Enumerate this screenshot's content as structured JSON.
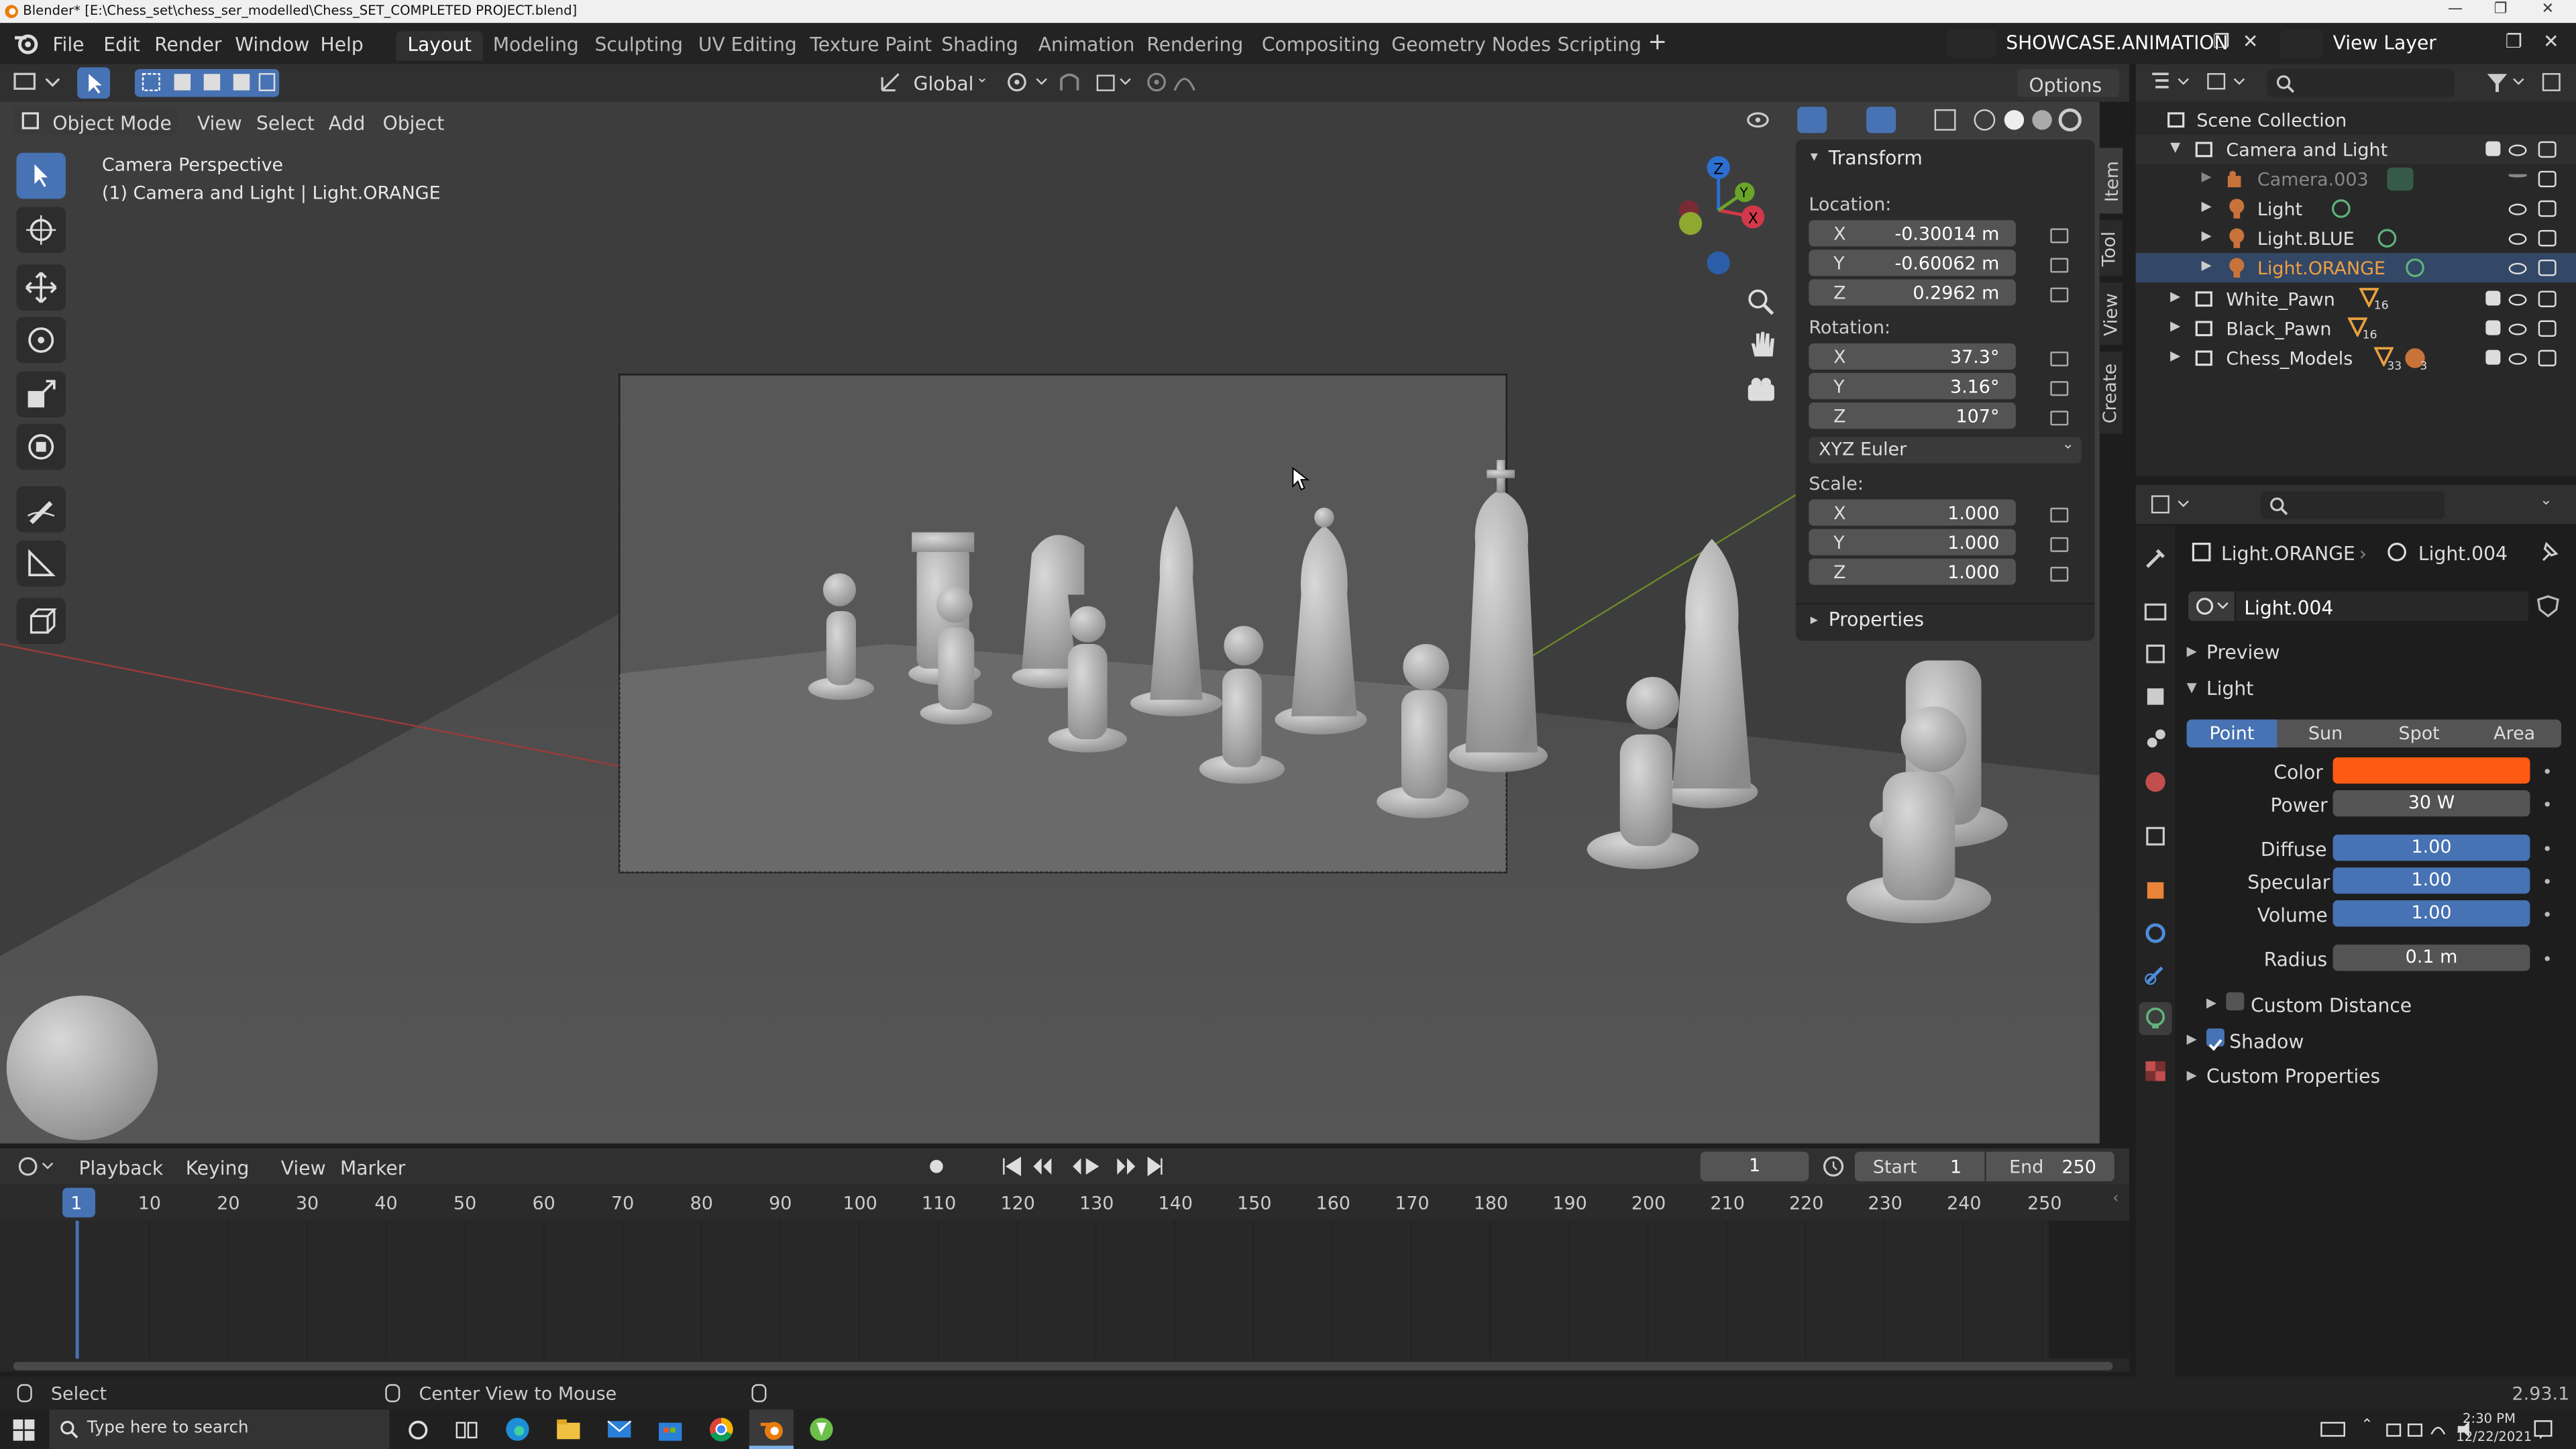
{
  "window": {
    "title": "Blender* [E:\\Chess_set\\chess_ser_modelled\\Chess_SET_COMPLETED PROJECT.blend]"
  },
  "menu": [
    "File",
    "Edit",
    "Render",
    "Window",
    "Help"
  ],
  "workspaces": [
    "Layout",
    "Modeling",
    "Sculpting",
    "UV Editing",
    "Texture Paint",
    "Shading",
    "Animation",
    "Rendering",
    "Compositing",
    "Geometry Nodes",
    "Scripting"
  ],
  "scene": {
    "name": "SHOWCASE.ANIMATION",
    "view_layer": "View Layer"
  },
  "toolbar": {
    "transform_orientation": "Global",
    "options": "Options"
  },
  "viewport_header": {
    "mode": "Object Mode",
    "menus": [
      "View",
      "Select",
      "Add",
      "Object"
    ]
  },
  "viewport": {
    "perspective": "Camera Perspective",
    "context": "(1) Camera and Light | Light.ORANGE",
    "gizmo_labels": {
      "x": "X",
      "y": "Y",
      "z": "Z"
    }
  },
  "npanel": {
    "header": "Transform",
    "location_label": "Location:",
    "location": [
      {
        "axis": "X",
        "value": "-0.30014 m"
      },
      {
        "axis": "Y",
        "value": "-0.60062 m"
      },
      {
        "axis": "Z",
        "value": "0.2962 m"
      }
    ],
    "rotation_label": "Rotation:",
    "rotation": [
      {
        "axis": "X",
        "value": "37.3°"
      },
      {
        "axis": "Y",
        "value": "3.16°"
      },
      {
        "axis": "Z",
        "value": "107°"
      }
    ],
    "rotation_mode": "XYZ Euler",
    "scale_label": "Scale:",
    "scale": [
      {
        "axis": "X",
        "value": "1.000"
      },
      {
        "axis": "Y",
        "value": "1.000"
      },
      {
        "axis": "Z",
        "value": "1.000"
      }
    ],
    "properties": "Properties",
    "tabs": [
      "Item",
      "Tool",
      "View",
      "Create"
    ]
  },
  "outliner": {
    "root": "Scene Collection",
    "items": [
      {
        "name": "Camera and Light",
        "type": "collection"
      },
      {
        "name": "Camera.003",
        "type": "camera"
      },
      {
        "name": "Light",
        "type": "light"
      },
      {
        "name": "Light.BLUE",
        "type": "light"
      },
      {
        "name": "Light.ORANGE",
        "type": "light"
      },
      {
        "name": "White_Pawn",
        "type": "collection",
        "badge": "16"
      },
      {
        "name": "Black_Pawn",
        "type": "collection",
        "badge": "16"
      },
      {
        "name": "Chess_Models",
        "type": "collection",
        "badge": "33",
        "badge2": "3"
      }
    ]
  },
  "properties": {
    "object": "Light.ORANGE",
    "data": "Light.004",
    "datablock": "Light.004",
    "sections": {
      "preview": "Preview",
      "light": "Light",
      "custom_distance": "Custom Distance",
      "shadow": "Shadow",
      "custom_props": "Custom Properties"
    },
    "light_types": [
      "Point",
      "Sun",
      "Spot",
      "Area"
    ],
    "active_type": "Point",
    "color_label": "Color",
    "color": "#ff5a14",
    "power_label": "Power",
    "power": "30 W",
    "diffuse_label": "Diffuse",
    "diffuse": "1.00",
    "specular_label": "Specular",
    "specular": "1.00",
    "volume_label": "Volume",
    "volume": "1.00",
    "radius_label": "Radius",
    "radius": "0.1 m"
  },
  "timeline": {
    "menus": [
      "Playback",
      "Keying",
      "View",
      "Marker"
    ],
    "current_frame": "1",
    "start_label": "Start",
    "start": "1",
    "end_label": "End",
    "end": "250",
    "ticks": [
      "1",
      "10",
      "20",
      "30",
      "40",
      "50",
      "60",
      "70",
      "80",
      "90",
      "100",
      "110",
      "120",
      "130",
      "140",
      "150",
      "160",
      "170",
      "180",
      "190",
      "200",
      "210",
      "220",
      "230",
      "240",
      "250"
    ]
  },
  "statusbar": {
    "left": "Select",
    "middle": "Center View to Mouse",
    "version": "2.93.1"
  },
  "taskbar": {
    "search": "Type here to search",
    "time": "2:30 PM",
    "date": "12/22/2021"
  }
}
